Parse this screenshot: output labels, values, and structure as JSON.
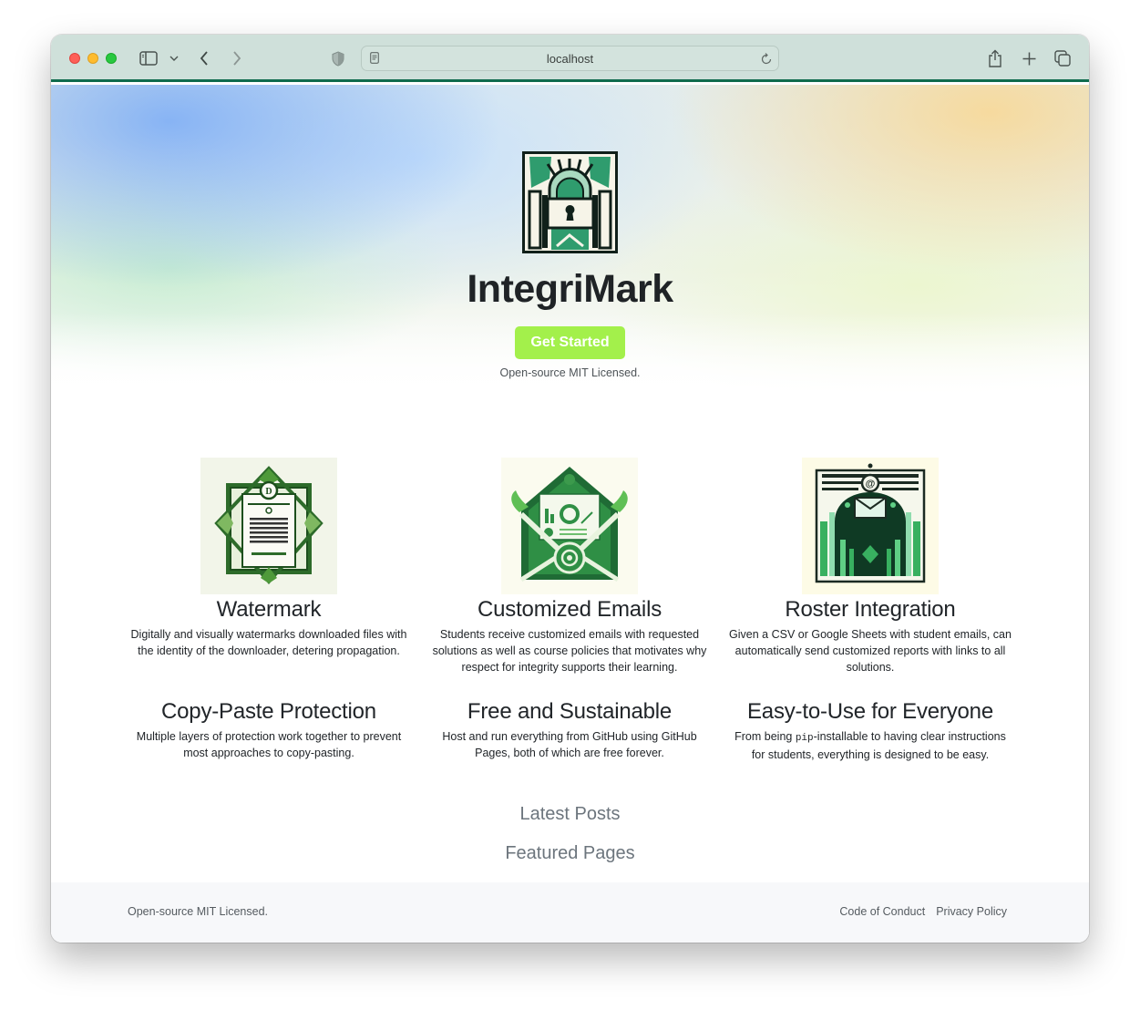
{
  "browser": {
    "url": "localhost",
    "icons": {
      "sidebar": "sidebar-icon",
      "chevron": "chevron-down-icon",
      "back": "chevron-left-icon",
      "forward": "chevron-right-icon",
      "privacy": "shield-icon",
      "page": "page-icon",
      "reload": "reload-icon",
      "share": "share-icon",
      "new_tab": "plus-icon",
      "tabs": "tabs-overview-icon"
    }
  },
  "hero": {
    "title": "IntegriMark",
    "cta_label": "Get Started",
    "subtitle": "Open-source MIT Licensed.",
    "logo_icon": "padlock-logo-icon"
  },
  "features": [
    {
      "title": "Watermark",
      "description": "Digitally and visually watermarks downloaded files with the identity of the downloader, detering propagation.",
      "image": "certificate-document-illustration"
    },
    {
      "title": "Customized Emails",
      "description": "Students receive customized emails with requested solutions as well as course policies that motivates why respect for integrity supports their learning.",
      "image": "envelope-report-illustration"
    },
    {
      "title": "Roster Integration",
      "description": "Given a CSV or Google Sheets with student emails, can automatically send customized reports with links to all solutions.",
      "image": "email-roster-illustration"
    },
    {
      "title": "Copy-Paste Protection",
      "description": "Multiple layers of protection work together to prevent most approaches to copy-pasting."
    },
    {
      "title": "Free and Sustainable",
      "description": "Host and run everything from GitHub using GitHub Pages, both of which are free forever."
    },
    {
      "title": "Easy-to-Use for Everyone",
      "description_prefix": "From being ",
      "description_code": "pip",
      "description_suffix": "-installable to having clear instructions for students, everything is designed to be easy."
    }
  ],
  "sections": {
    "latest_posts": "Latest Posts",
    "featured_pages": "Featured Pages"
  },
  "footer": {
    "license": "Open-source MIT Licensed.",
    "links": [
      "Code of Conduct",
      "Privacy Policy"
    ]
  },
  "colors": {
    "accent_green": "#a3f04b",
    "brand_dark_green": "#0f6b4d",
    "toolbar_bg": "#cfe0da"
  }
}
